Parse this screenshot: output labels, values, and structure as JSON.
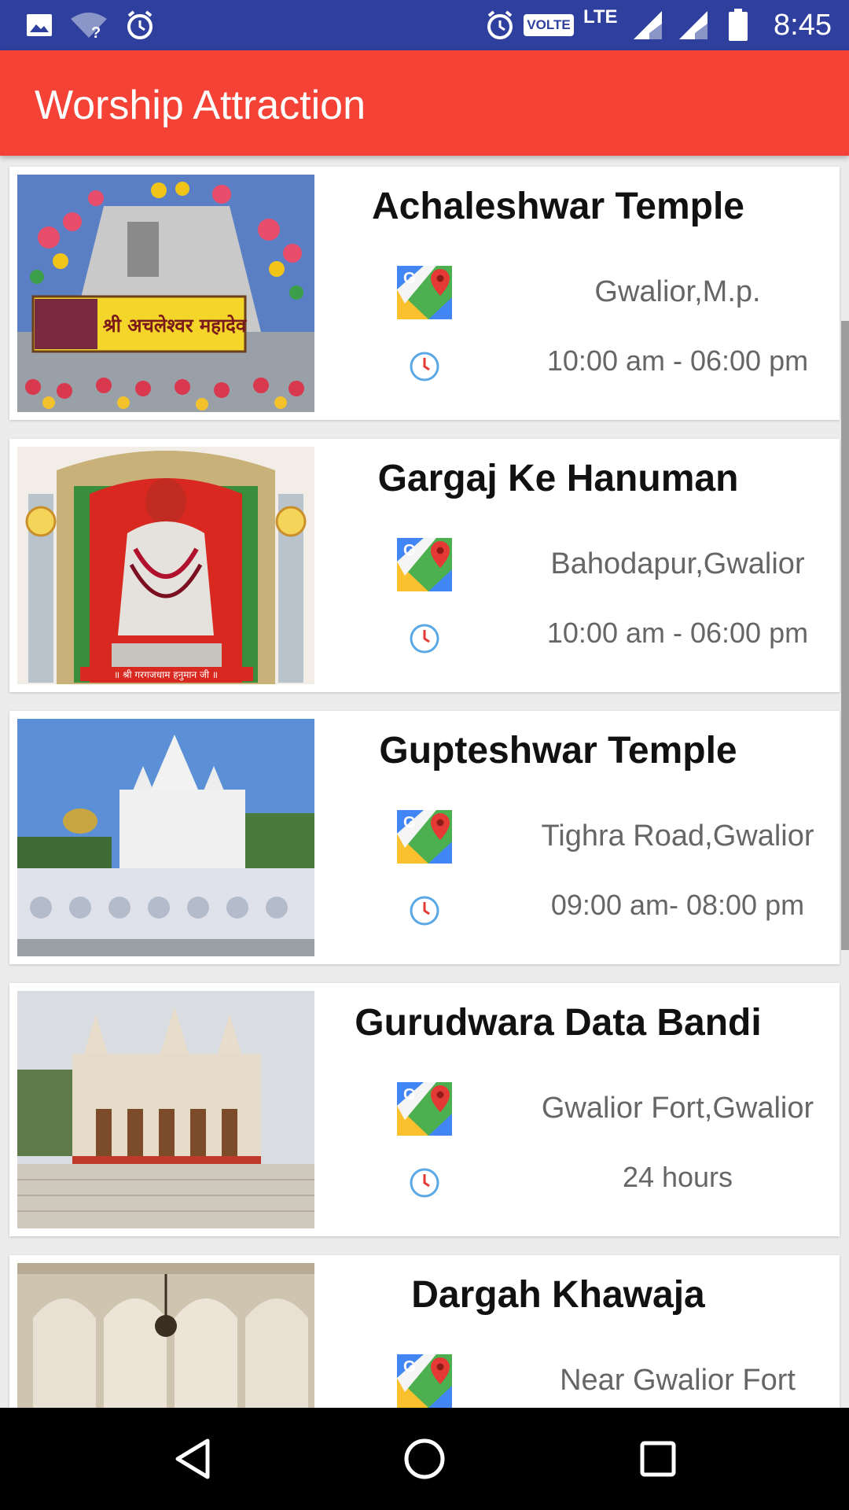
{
  "status_bar": {
    "time": "8:45",
    "network_badge": "VOLTE",
    "network_type": "LTE",
    "icons": [
      "image-icon",
      "wifi-unknown-icon",
      "alarm-icon",
      "alarm-icon",
      "signal-icon",
      "signal-icon",
      "battery-icon"
    ]
  },
  "toolbar": {
    "title": "Worship Attraction"
  },
  "places": [
    {
      "name": "Achaleshwar Temple",
      "location": "Gwalior,M.p.",
      "hours": "10:00 am - 06:00 pm",
      "image_label": "श्री अचलेश्वर महादेव"
    },
    {
      "name": "Gargaj Ke Hanuman",
      "location": "Bahodapur,Gwalior",
      "hours": "10:00 am - 06:00 pm",
      "image_label": "॥ श्री गरगजधाम हनुमान जी ॥"
    },
    {
      "name": "Gupteshwar Temple",
      "location": "Tighra Road,Gwalior",
      "hours": "09:00 am- 08:00 pm"
    },
    {
      "name": "Gurudwara Data Bandi",
      "location": "Gwalior Fort,Gwalior",
      "hours": "24 hours"
    },
    {
      "name": "Dargah Khawaja",
      "location": "Near Gwalior Fort",
      "hours": ""
    }
  ],
  "colors": {
    "status_bar": "#2f3f9e",
    "toolbar": "#f44336",
    "text_secondary": "#666666"
  },
  "nav_bar": {
    "icons": [
      "back-icon",
      "home-icon",
      "recents-icon"
    ]
  }
}
